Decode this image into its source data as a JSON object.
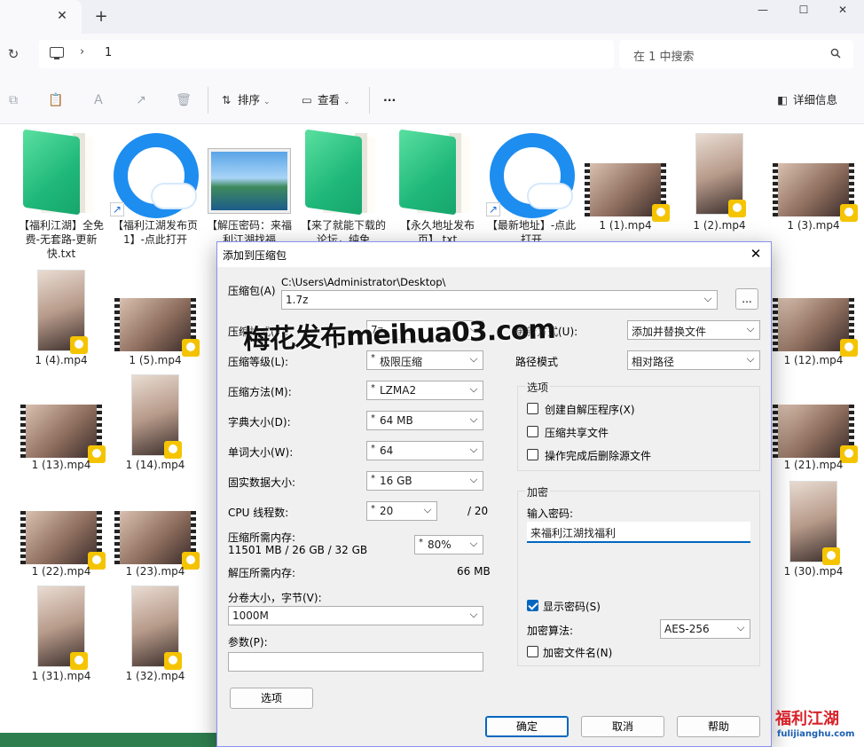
{
  "window": {
    "tab_close": "✕",
    "new_tab": "+",
    "minimize": "—",
    "maximize": "☐",
    "close": "✕"
  },
  "address": {
    "path_segment": "1",
    "search_placeholder": "在 1 中搜索"
  },
  "toolbar": {
    "sort": "排序",
    "view": "查看",
    "more": "···",
    "details": "详细信息"
  },
  "files": [
    {
      "name": "【福利江湖】全免费-无套路-更新快.txt",
      "kind": "txt"
    },
    {
      "name": "【福利江湖发布页1】-点此打开",
      "kind": "url"
    },
    {
      "name": "【解压密码：来福利江湖找福",
      "kind": "image"
    },
    {
      "name": "【来了就能下载的论坛，纯免",
      "kind": "txt"
    },
    {
      "name": "【永久地址发布页】.txt",
      "kind": "txt"
    },
    {
      "name": "【最新地址】-点此打开",
      "kind": "url"
    },
    {
      "name": "1 (1).mp4",
      "kind": "video"
    },
    {
      "name": "1 (2).mp4",
      "kind": "portrait"
    },
    {
      "name": "1 (3).mp4",
      "kind": "video"
    },
    {
      "name": "1 (4).mp4",
      "kind": "portrait"
    },
    {
      "name": "1 (5).mp4",
      "kind": "video"
    },
    {
      "name": "1 (12).mp4",
      "kind": "video"
    },
    {
      "name": "1 (13).mp4",
      "kind": "video"
    },
    {
      "name": "1 (14).mp4",
      "kind": "portrait"
    },
    {
      "name": "1 (21).mp4",
      "kind": "video"
    },
    {
      "name": "1 (22).mp4",
      "kind": "video"
    },
    {
      "name": "1 (23).mp4",
      "kind": "video"
    },
    {
      "name": "1 (30).mp4",
      "kind": "portrait"
    },
    {
      "name": "1 (31).mp4",
      "kind": "portrait"
    },
    {
      "name": "1 (32).mp4",
      "kind": "portrait"
    }
  ],
  "dialog": {
    "title": "添加到压缩包",
    "archive_label": "压缩包(A)",
    "archive_dir": "C:\\Users\\Administrator\\Desktop\\",
    "archive_name": "1.7z",
    "browse": "...",
    "format_label": "压缩格式(F):",
    "format_value": "7z",
    "level_label": "压缩等级(L):",
    "level_value": "极限压缩",
    "method_label": "压缩方法(M):",
    "method_value": "LZMA2",
    "dict_label": "字典大小(D):",
    "dict_value": "64 MB",
    "word_label": "单词大小(W):",
    "word_value": "64",
    "solid_label": "固实数据大小:",
    "solid_value": "16 GB",
    "threads_label": "CPU 线程数:",
    "threads_value": "20",
    "threads_max": "/ 20",
    "mem_comp_label": "压缩所需内存:",
    "mem_comp_value": "11501 MB / 26 GB / 32 GB",
    "mem_pct": "80%",
    "mem_decomp_label": "解压所需内存:",
    "mem_decomp_value": "66 MB",
    "split_label": "分卷大小，字节(V):",
    "split_value": "1000M",
    "params_label": "参数(P):",
    "params_value": "",
    "options_btn": "选项",
    "update_label": "更新方式(U):",
    "update_value": "添加并替换文件",
    "path_label": "路径模式",
    "path_value": "相对路径",
    "options_group": "选项",
    "opt_sfx": "创建自解压程序(X)",
    "opt_shared": "压缩共享文件",
    "opt_delete": "操作完成后删除源文件",
    "encrypt_group": "加密",
    "pwd_label": "输入密码:",
    "pwd_value": "来福利江湖找福利",
    "show_pwd": "显示密码(S)",
    "algo_label": "加密算法:",
    "algo_value": "AES-256",
    "encrypt_names": "加密文件名(N)",
    "ok": "确定",
    "cancel": "取消",
    "help": "帮助"
  },
  "overlay": {
    "watermark": "梅花发布meihua03.com",
    "logo_main": "福利江湖",
    "logo_sub": "fulijianghu.com"
  }
}
